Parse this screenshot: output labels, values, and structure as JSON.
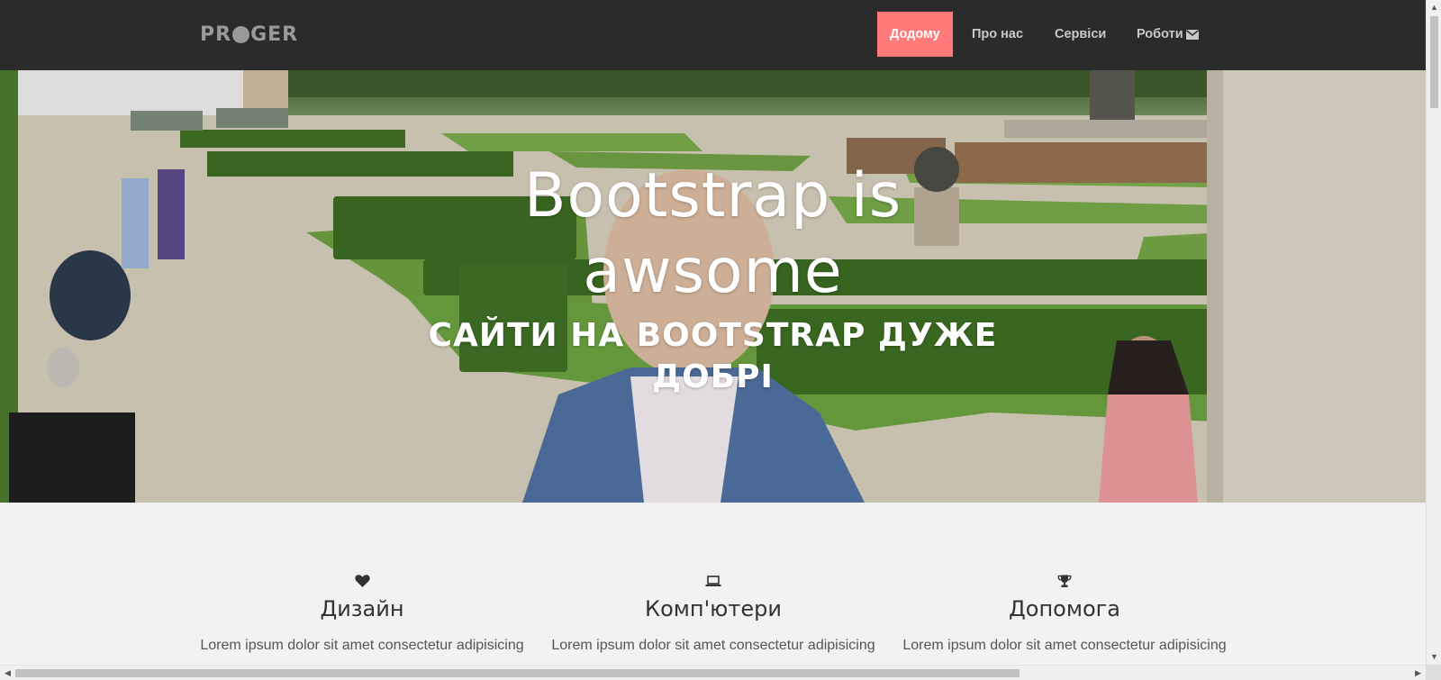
{
  "navbar": {
    "logo": {
      "before": "PR",
      "after": "GER"
    },
    "items": [
      {
        "label": "Додому",
        "active": true
      },
      {
        "label": "Про нас",
        "active": false
      },
      {
        "label": "Сервіси",
        "active": false
      },
      {
        "label": "Роботи",
        "active": false
      }
    ],
    "mail_icon": "envelope-icon",
    "background": "#2b2b2b",
    "active_color": "#ff7a78"
  },
  "hero": {
    "title_line1": "Bootstrap is",
    "title_line2": "awsome",
    "subtitle_line1": "САЙТИ НА BOOTSTRAP ДУЖЕ",
    "subtitle_line2": "ДОБРІ"
  },
  "features": [
    {
      "icon": "heart-icon",
      "title": "Дизайн",
      "text": "Lorem ipsum dolor sit amet consectetur adipisicing"
    },
    {
      "icon": "laptop-icon",
      "title": "Комп'ютери",
      "text": "Lorem ipsum dolor sit amet consectetur adipisicing"
    },
    {
      "icon": "trophy-icon",
      "title": "Допомога",
      "text": "Lorem ipsum dolor sit amet consectetur adipisicing"
    }
  ]
}
